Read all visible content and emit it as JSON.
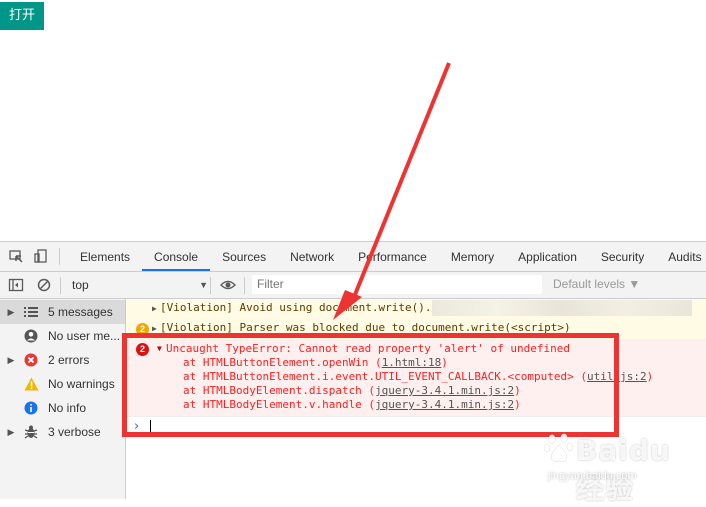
{
  "page": {
    "open_button": "打开"
  },
  "devtools": {
    "tabs": [
      "Elements",
      "Console",
      "Sources",
      "Network",
      "Performance",
      "Memory",
      "Application",
      "Security",
      "Audits"
    ],
    "active_tab": "Console",
    "toolbar": {
      "context": "top",
      "filter_placeholder": "Filter",
      "levels": "Default levels ▼"
    },
    "sidebar": [
      {
        "label": "5 messages",
        "icon": "list-icon",
        "count": 5
      },
      {
        "label": "No user me...",
        "icon": "user-icon"
      },
      {
        "label": "2 errors",
        "icon": "error-icon",
        "count": 2
      },
      {
        "label": "No warnings",
        "icon": "warning-icon"
      },
      {
        "label": "No info",
        "icon": "info-icon"
      },
      {
        "label": "3 verbose",
        "icon": "bug-icon",
        "count": 3
      }
    ],
    "messages": {
      "warn1": "[Violation] Avoid using document.write().",
      "warn2_badge": "2",
      "warn2": "[Violation] Parser was blocked due to document.write(<script>)",
      "error_badge": "2",
      "error_title": "Uncaught TypeError: Cannot read property 'alert' of undefined",
      "stack": [
        {
          "prefix": "at HTMLButtonElement.openWin (",
          "link": "1.html:18",
          "suffix": ")"
        },
        {
          "prefix": "at HTMLButtonElement.i.event.UTIL_EVENT_CALLBACK.<computed> (",
          "link": "util.js:2",
          "suffix": ")"
        },
        {
          "prefix": "at HTMLBodyElement.dispatch (",
          "link": "jquery-3.4.1.min.js:2",
          "suffix": ")"
        },
        {
          "prefix": "at HTMLBodyElement.v.handle (",
          "link": "jquery-3.4.1.min.js:2",
          "suffix": ")"
        }
      ]
    }
  },
  "watermark": {
    "brand": "Baidu 经验",
    "url": "jingyan.baidu.com"
  },
  "colors": {
    "highlight": "#ee3333",
    "accent": "#009688",
    "error": "#fe2020"
  }
}
